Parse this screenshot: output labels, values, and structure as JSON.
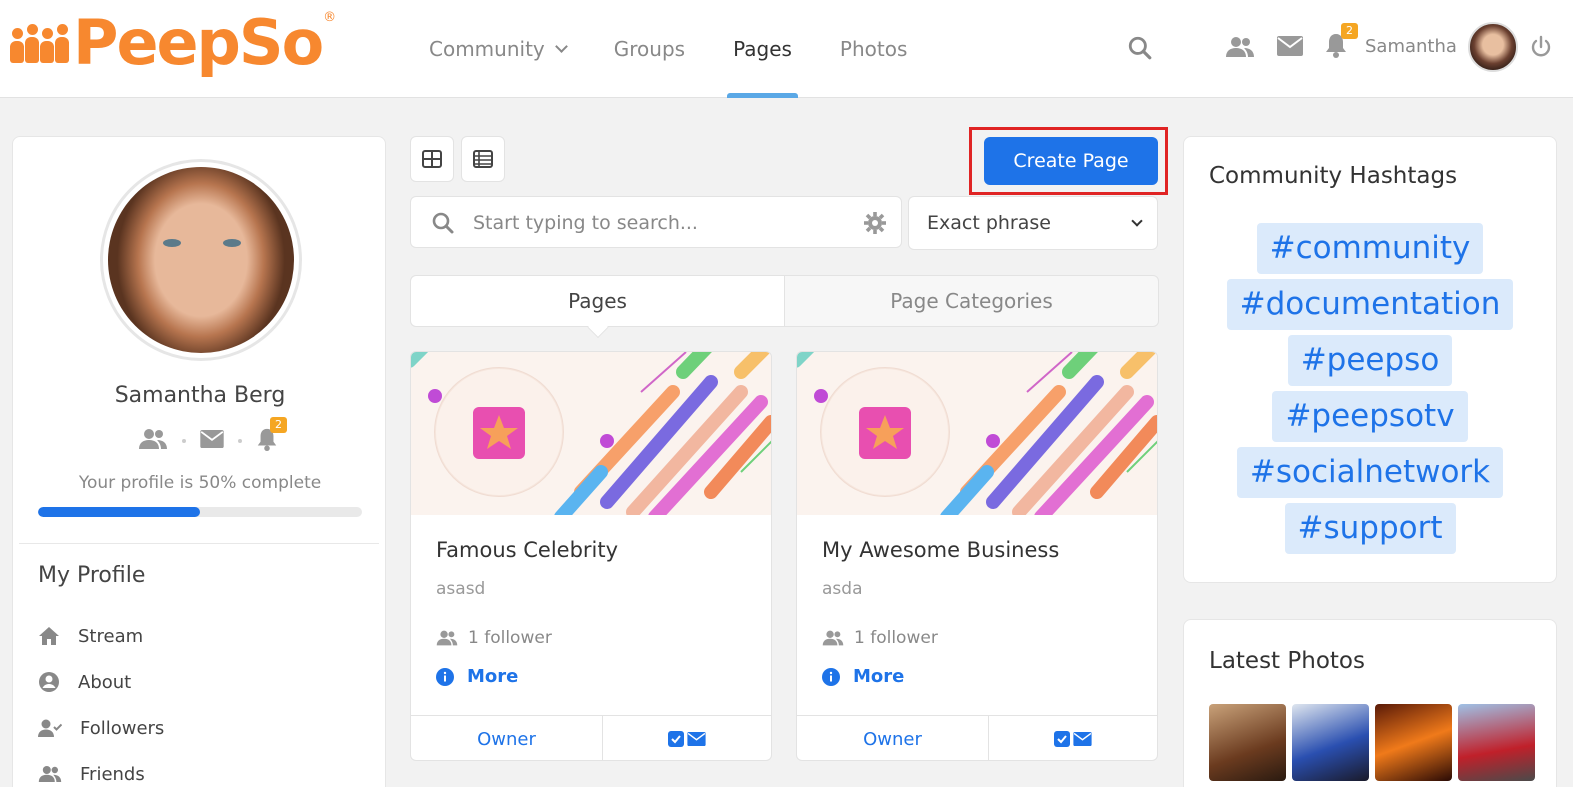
{
  "header": {
    "logo_text": "PeepSo",
    "logo_reg": "®",
    "nav": [
      {
        "label": "Community"
      },
      {
        "label": "Groups"
      },
      {
        "label": "Pages"
      },
      {
        "label": "Photos"
      }
    ],
    "notification_count": "2",
    "username": "Samantha"
  },
  "profile": {
    "name": "Samantha Berg",
    "notification_count": "2",
    "complete_text": "Your profile is 50% complete",
    "complete_fraction": 0.5,
    "section_title": "My Profile",
    "menu": [
      {
        "label": "Stream",
        "icon": "home-icon"
      },
      {
        "label": "About",
        "icon": "user-circle-icon"
      },
      {
        "label": "Followers",
        "icon": "user-check-icon"
      },
      {
        "label": "Friends",
        "icon": "users-icon"
      }
    ]
  },
  "toolbar": {
    "create_label": "Create Page",
    "search_placeholder": "Start typing to search...",
    "select_value": "Exact phrase"
  },
  "tabs": [
    {
      "label": "Pages"
    },
    {
      "label": "Page Categories"
    }
  ],
  "pages": [
    {
      "title": "Famous Celebrity",
      "desc": "asasd",
      "followers": "1 follower",
      "more": "More",
      "owner": "Owner"
    },
    {
      "title": "My Awesome Business",
      "desc": "asda",
      "followers": "1 follower",
      "more": "More",
      "owner": "Owner"
    }
  ],
  "hashtags": {
    "title": "Community Hashtags",
    "items": [
      "#community",
      "#documentation",
      "#peepso",
      "#peepsotv",
      "#socialnetwork",
      "#support"
    ]
  },
  "latest_photos": {
    "title": "Latest Photos"
  },
  "colors": {
    "brand": "#f7882f",
    "accent": "#1e73e8",
    "highlight_border": "#e02424",
    "badge": "#f5a623"
  }
}
